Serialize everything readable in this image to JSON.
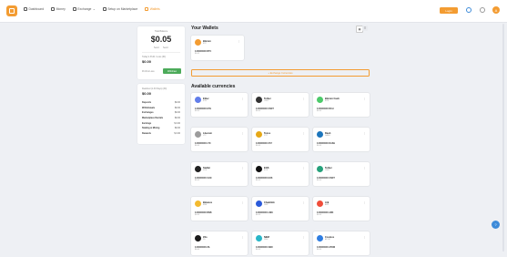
{
  "nav": {
    "items": [
      {
        "label": "Dashboard"
      },
      {
        "label": "Money"
      },
      {
        "label": "Exchange"
      },
      {
        "label": "Setup on Marketplace"
      },
      {
        "label": "Wallets"
      }
    ],
    "action_label": "Login",
    "avatar_initial": "A"
  },
  "summary": {
    "total_label": "Total Balance",
    "total_value": "$0.05",
    "sub_left": "Send",
    "sub_right": "Send",
    "today_label": "Today's Profit / Loss (ID)",
    "today_value": "$0.00",
    "pnl_label": "Profit & Loss",
    "pnl_button": "Withdraw"
  },
  "stats": {
    "title": "Realized (1-30 Days) (ID)",
    "value": "$0.00",
    "rows": [
      {
        "k": "Deposits",
        "v": "$0.00"
      },
      {
        "k": "Withdrawals",
        "v": "$0.00"
      },
      {
        "k": "Exchanges",
        "v": "$0.00"
      },
      {
        "k": "Marketplace Rentals",
        "v": "$0.00"
      },
      {
        "k": "Earnings",
        "v": "$ 0.00"
      },
      {
        "k": "Staking & Mining",
        "v": "$0.00"
      },
      {
        "k": "Rewards",
        "v": "$ 0.00"
      }
    ]
  },
  "wallets": {
    "title": "Your Wallets",
    "list": [
      {
        "name": "Bitcoin",
        "symbol": "BTC",
        "balance": "0.00000000 BTC",
        "usd": "$0.05",
        "color": "#f39c32"
      }
    ],
    "add_label": "+ Exchange Currencies"
  },
  "available": {
    "title": "Available currencies",
    "list": [
      {
        "name": "Ether",
        "symbol": "ETH",
        "balance": "0.00000000 ETH",
        "usd": "$0.00",
        "color": "#627eea"
      },
      {
        "name": "Tether",
        "symbol": "USDT",
        "balance": "0.00000000 USDT",
        "usd": "$0.00",
        "color": "#333333"
      },
      {
        "name": "Bitcoin Cash",
        "symbol": "BCH",
        "balance": "0.00000000 BCH",
        "usd": "$0.00",
        "color": "#4cca6a"
      },
      {
        "name": "Litecoin",
        "symbol": "LTC",
        "balance": "0.00000000 LTC",
        "usd": "$0.00",
        "color": "#9c9c9c"
      },
      {
        "name": "Tezos",
        "symbol": "XTZ",
        "balance": "0.00000000 XTZ",
        "usd": "$0.00",
        "color": "#e6a817"
      },
      {
        "name": "Dash",
        "symbol": "DASH",
        "balance": "0.00000000 DASH",
        "usd": "$0.00",
        "color": "#1c75bc"
      },
      {
        "name": "Stellar",
        "symbol": "XLM",
        "balance": "0.00000000 XLM",
        "usd": "$0.00",
        "color": "#222222"
      },
      {
        "name": "EOS",
        "symbol": "EOS",
        "balance": "0.00000000 EOS",
        "usd": "$0.00",
        "color": "#111111"
      },
      {
        "name": "Tether",
        "symbol": "USDT",
        "balance": "0.00000000 USDT",
        "usd": "$0.00",
        "color": "#26a17b"
      },
      {
        "name": "Binance",
        "symbol": "BNB",
        "balance": "0.00000000 BNB",
        "usd": "$0.00",
        "color": "#f3ba2f"
      },
      {
        "name": "Chainlink",
        "symbol": "LINK",
        "balance": "0.00000000 LINK",
        "usd": "$0.00",
        "color": "#2a5ada"
      },
      {
        "name": "Ark",
        "symbol": "ARK",
        "balance": "0.00000000 ARK",
        "usd": "$0.00",
        "color": "#f04d3a"
      },
      {
        "name": "Zilo",
        "symbol": "ZIL",
        "balance": "0.00000000 ZIL",
        "usd": "$0.00",
        "color": "#1b1b1b"
      },
      {
        "name": "NEM",
        "symbol": "XEM",
        "balance": "0.00000000 XEM",
        "usd": "$0.00",
        "color": "#29b6c8"
      },
      {
        "name": "Cosmos",
        "symbol": "ATOM",
        "balance": "0.00000000 ATOM",
        "usd": "$0.00",
        "color": "#2f7de1"
      }
    ]
  }
}
